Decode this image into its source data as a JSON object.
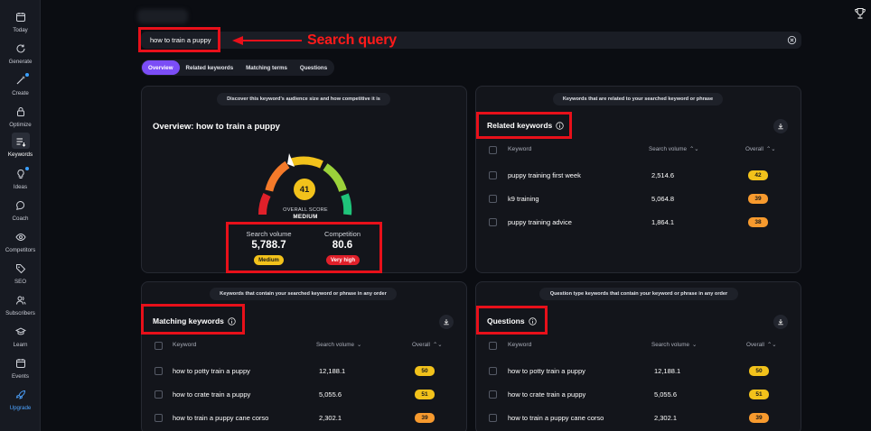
{
  "sidebar": {
    "items": [
      {
        "label": "Today",
        "icon": "calendar-icon"
      },
      {
        "label": "Generate",
        "icon": "refresh-icon"
      },
      {
        "label": "Create",
        "icon": "wand-icon"
      },
      {
        "label": "Optimize",
        "icon": "lock-icon"
      },
      {
        "label": "Keywords",
        "icon": "keywords-icon"
      },
      {
        "label": "Ideas",
        "icon": "lightbulb-icon"
      },
      {
        "label": "Coach",
        "icon": "chat-icon"
      },
      {
        "label": "Competitors",
        "icon": "eye-icon"
      },
      {
        "label": "SEO",
        "icon": "tag-icon"
      },
      {
        "label": "Subscribers",
        "icon": "users-icon"
      },
      {
        "label": "Learn",
        "icon": "graduation-cap-icon"
      },
      {
        "label": "Events",
        "icon": "calendar-icon"
      },
      {
        "label": "Upgrade",
        "icon": "rocket-icon"
      }
    ],
    "active": "Keywords"
  },
  "search": {
    "query": "how to train a puppy",
    "annotation": "Search query"
  },
  "tabs": [
    "Overview",
    "Related keywords",
    "Matching terms",
    "Questions"
  ],
  "overview": {
    "pill": "Discover this keyword's audience size and how competitive it is",
    "title": "Overview: how to train a puppy",
    "score": "41",
    "score_fraction": 0.41,
    "score_label": "OVERALL SCORE",
    "score_level": "MEDIUM",
    "search_volume_label": "Search volume",
    "search_volume": "5,788.7",
    "search_volume_badge": "Medium",
    "competition_label": "Competition",
    "competition": "80.6",
    "competition_badge": "Very high",
    "colors": {
      "medium": "#f2c21b",
      "very_high": "#e0202a"
    }
  },
  "related": {
    "pill": "Keywords that are related to your searched keyword or phrase",
    "title": "Related keywords",
    "columns": [
      "Keyword",
      "Search volume",
      "Overall"
    ],
    "rows": [
      {
        "keyword": "puppy training first week",
        "volume": "2,514.6",
        "score": "42",
        "color": "#f2c21b"
      },
      {
        "keyword": "k9 training",
        "volume": "5,064.8",
        "score": "39",
        "color": "#f79a2e"
      },
      {
        "keyword": "puppy training advice",
        "volume": "1,864.1",
        "score": "38",
        "color": "#f79a2e"
      }
    ]
  },
  "matching": {
    "pill": "Keywords that contain your searched keyword or phrase in any order",
    "title": "Matching keywords",
    "columns": [
      "Keyword",
      "Search volume",
      "Overall"
    ],
    "rows": [
      {
        "keyword": "how to potty train a puppy",
        "volume": "12,188.1",
        "score": "50",
        "color": "#f2c21b"
      },
      {
        "keyword": "how to crate train a puppy",
        "volume": "5,055.6",
        "score": "51",
        "color": "#f2c21b"
      },
      {
        "keyword": "how to train a puppy cane corso",
        "volume": "2,302.1",
        "score": "39",
        "color": "#f79a2e"
      }
    ]
  },
  "questions": {
    "pill": "Question type keywords that contain your keyword or phrase in any order",
    "title": "Questions",
    "columns": [
      "Keyword",
      "Search volume",
      "Overall"
    ],
    "rows": [
      {
        "keyword": "how to potty train a puppy",
        "volume": "12,188.1",
        "score": "50",
        "color": "#f2c21b"
      },
      {
        "keyword": "how to crate train a puppy",
        "volume": "5,055.6",
        "score": "51",
        "color": "#f2c21b"
      },
      {
        "keyword": "how to train a puppy cane corso",
        "volume": "2,302.1",
        "score": "39",
        "color": "#f79a2e"
      }
    ]
  },
  "annotation_color": "#e8101a"
}
